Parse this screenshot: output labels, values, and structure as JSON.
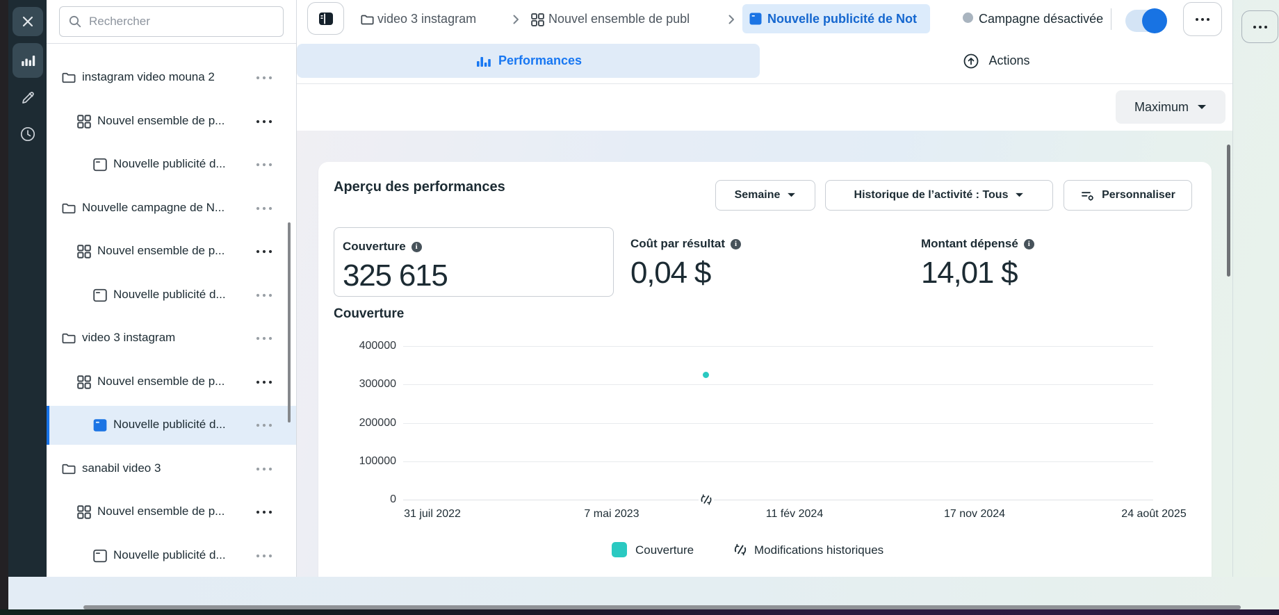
{
  "colors": {
    "accent": "#1877f2",
    "series_teal": "#2ac9c1",
    "selected_row_bg": "#e2edf9",
    "tab_selected_bg": "#e0ebf8",
    "rail_bg": "#1d2b33"
  },
  "sidebar": {
    "search_placeholder": "Rechercher",
    "rows": [
      {
        "label": "instagram video mouna 2",
        "level": 1,
        "type": "campaign"
      },
      {
        "label": "Nouvel ensemble de p...",
        "level": 2,
        "type": "adset",
        "dots": "dark"
      },
      {
        "label": "Nouvelle publicité d...",
        "level": 3,
        "type": "ad"
      },
      {
        "label": "Nouvelle campagne de N...",
        "level": 1,
        "type": "campaign"
      },
      {
        "label": "Nouvel ensemble de p...",
        "level": 2,
        "type": "adset",
        "dots": "dark"
      },
      {
        "label": "Nouvelle publicité d...",
        "level": 3,
        "type": "ad"
      },
      {
        "label": "video 3 instagram",
        "level": 1,
        "type": "campaign"
      },
      {
        "label": "Nouvel ensemble de p...",
        "level": 2,
        "type": "adset",
        "dots": "dark"
      },
      {
        "label": "Nouvelle publicité d...",
        "level": 3,
        "type": "ad",
        "selected": true
      },
      {
        "label": "sanabil video 3",
        "level": 1,
        "type": "campaign"
      },
      {
        "label": "Nouvel ensemble de p...",
        "level": 2,
        "type": "adset",
        "dots": "dark"
      },
      {
        "label": "Nouvelle publicité d...",
        "level": 3,
        "type": "ad"
      }
    ]
  },
  "breadcrumb": {
    "items": [
      {
        "label": "video 3 instagram",
        "type": "campaign"
      },
      {
        "label": "Nouvel ensemble de publ",
        "type": "adset"
      },
      {
        "label": "Nouvelle publicité de Not",
        "type": "ad",
        "active": true
      }
    ]
  },
  "header": {
    "status_label": "Campagne désactivée",
    "toggle_on": true
  },
  "tabs": [
    {
      "label": "Performances",
      "selected": true
    },
    {
      "label": "Actions",
      "selected": false
    }
  ],
  "controls": {
    "maximum_label": "Maximum",
    "week_label": "Semaine",
    "history_label": "Historique de l’activité : Tous",
    "personalize_label": "Personnaliser"
  },
  "overview": {
    "title": "Aperçu des performances",
    "metrics": [
      {
        "label": "Couverture",
        "value": "325 615",
        "boxed": true
      },
      {
        "label": "Coût par résultat",
        "value": "0,04 $"
      },
      {
        "label": "Montant dépensé",
        "value": "14,01 $"
      }
    ]
  },
  "chart_data": {
    "type": "scatter",
    "title": "Couverture",
    "x_tick_labels": [
      "31 juil 2022",
      "7 mai 2023",
      "11 fév 2024",
      "17 nov 2024",
      "24 août 2025"
    ],
    "y_ticks": [
      400000,
      300000,
      200000,
      100000,
      0
    ],
    "ylim": [
      0,
      400000
    ],
    "grid": true,
    "legend": [
      "Couverture",
      "Modifications historiques"
    ],
    "points": [
      {
        "x_frac": 0.404,
        "x_date_estimate": "nov 2023",
        "y": 325615
      }
    ],
    "history_markers": [
      {
        "x_frac": 0.404
      }
    ],
    "series_color": "#2ac9c1"
  }
}
